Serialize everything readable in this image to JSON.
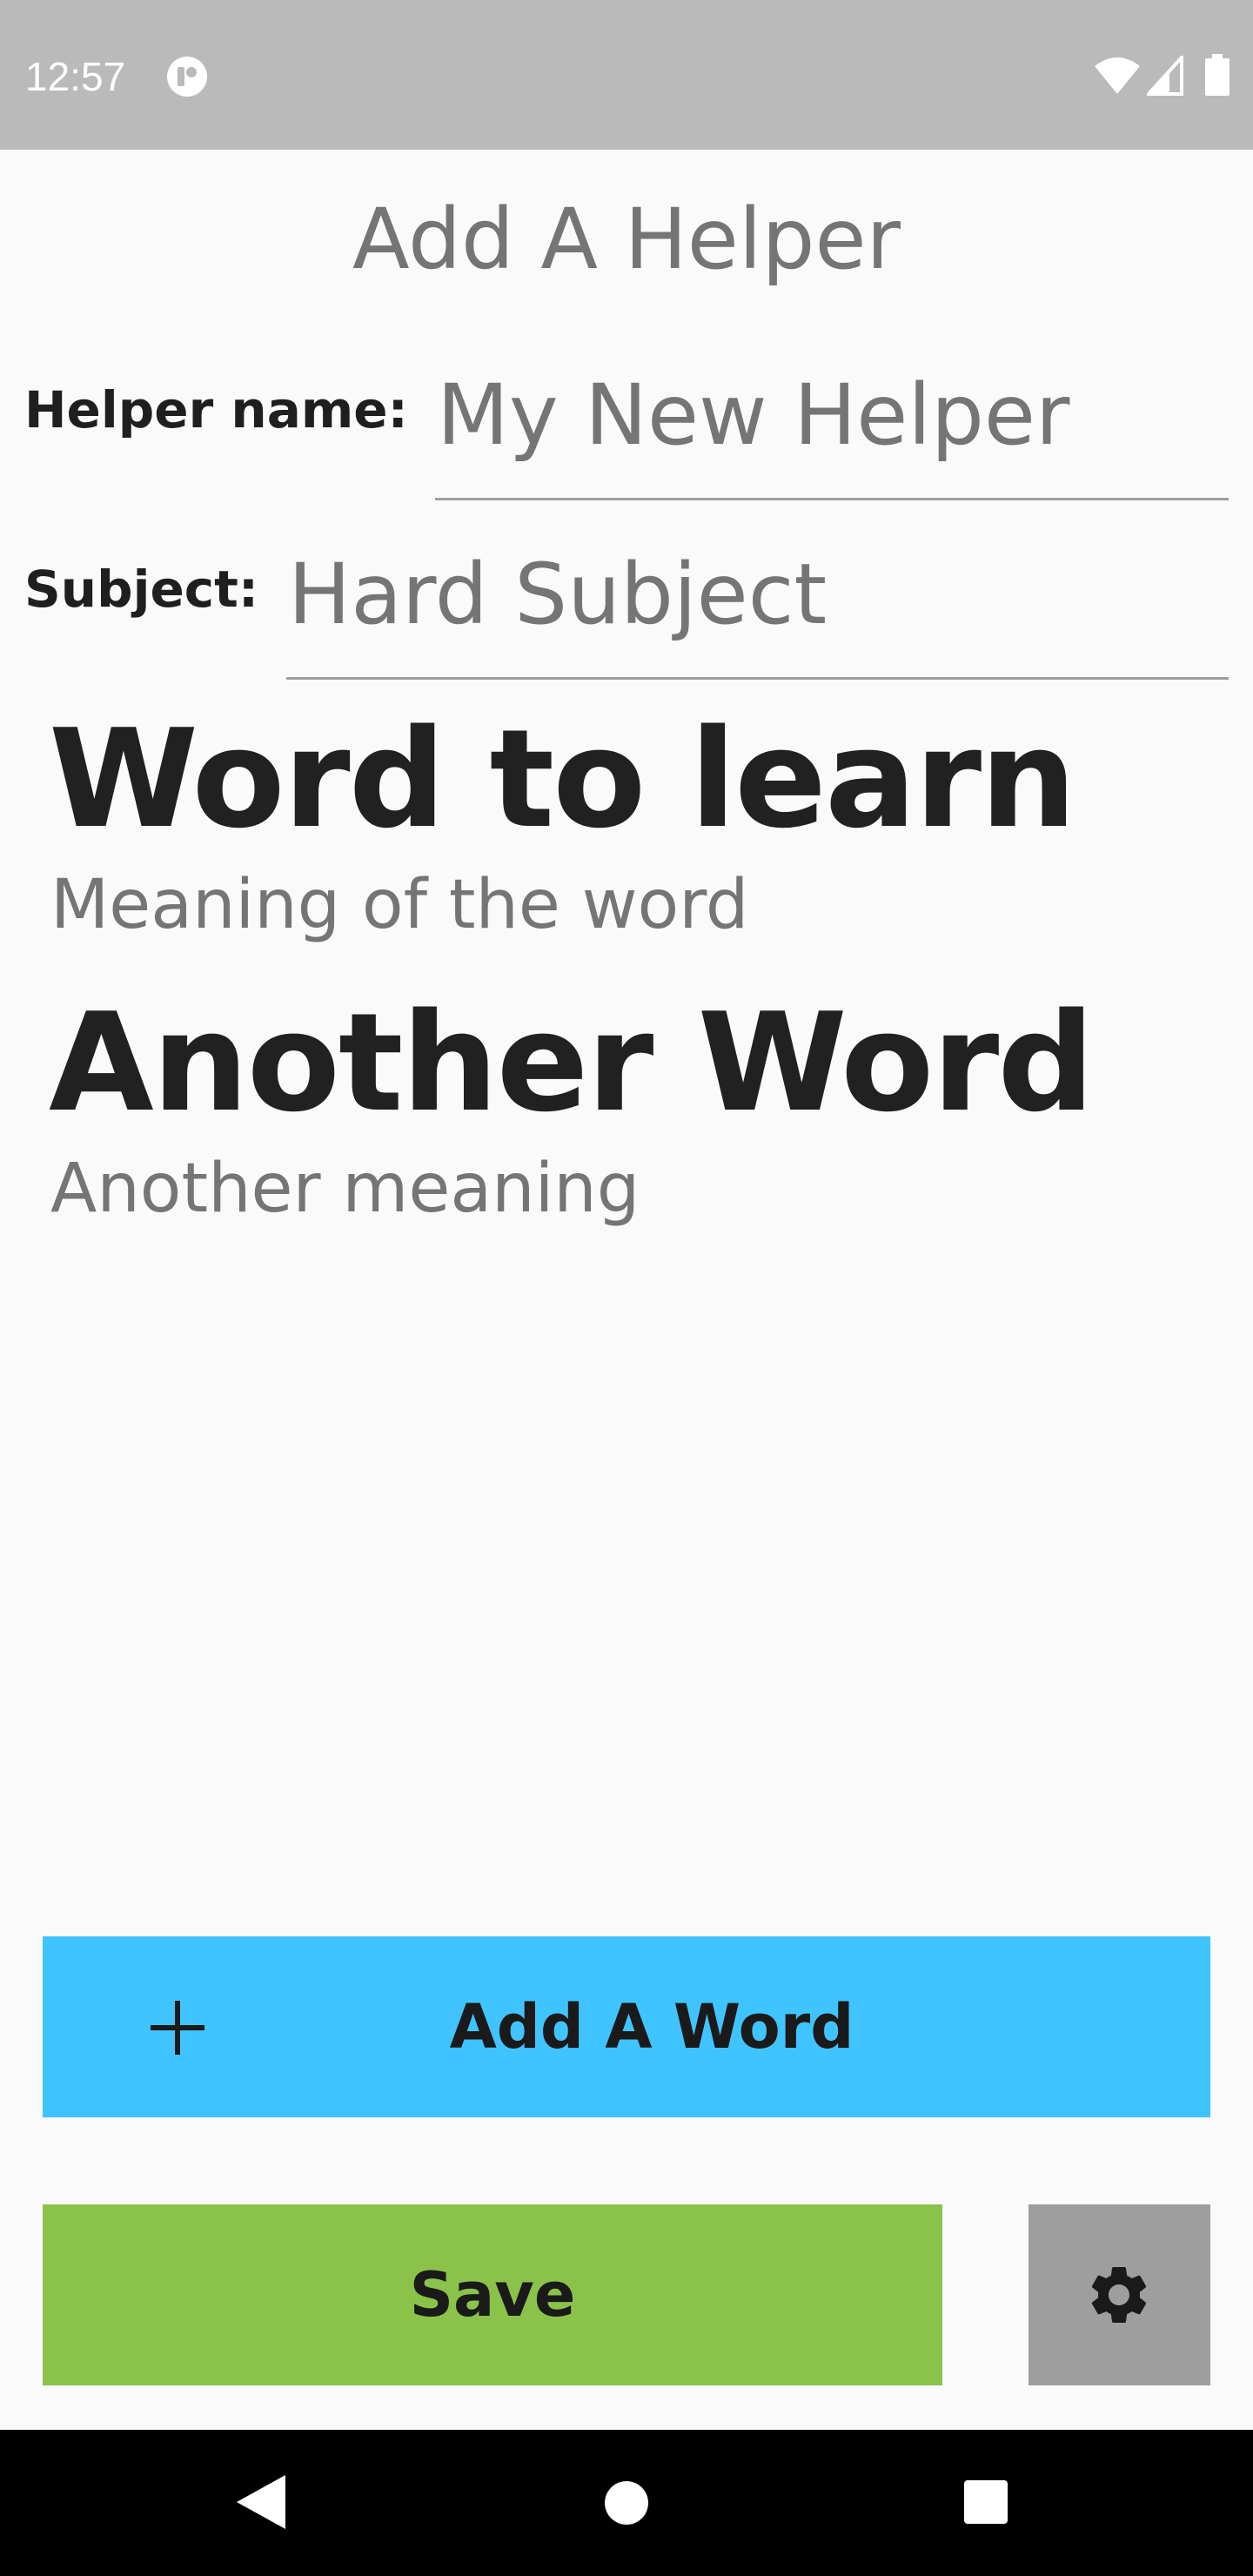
{
  "status_bar": {
    "time": "12:57",
    "icons": [
      "notification-icon",
      "wifi-icon",
      "signal-icon",
      "battery-icon"
    ]
  },
  "page": {
    "title": "Add A Helper"
  },
  "form": {
    "helper_name_label": "Helper name:",
    "helper_name_value": "My New Helper",
    "subject_label": "Subject:",
    "subject_value": "Hard Subject"
  },
  "words": [
    {
      "term": "Word to learn",
      "meaning": "Meaning of the word"
    },
    {
      "term": "Another Word",
      "meaning": "Another meaning"
    }
  ],
  "actions": {
    "add_word_label": "Add A Word",
    "add_word_icon": "plus-icon",
    "save_label": "Save",
    "settings_icon": "gear-icon"
  },
  "colors": {
    "status_bar": "#bababa",
    "background": "#fafafa",
    "add_word_button": "#40c4ff",
    "save_button": "#8bc34a",
    "settings_button": "#9e9e9e",
    "nav_bar": "#000000"
  },
  "nav_bar": {
    "icons": [
      "back-icon",
      "home-icon",
      "recents-icon"
    ]
  }
}
